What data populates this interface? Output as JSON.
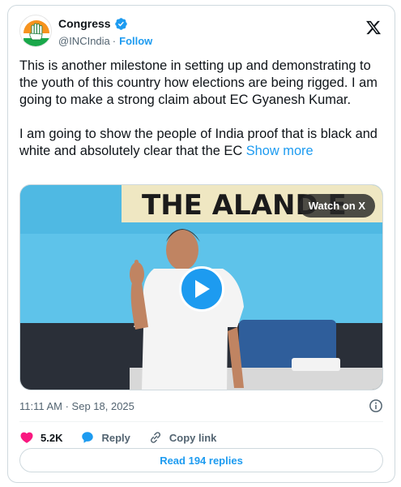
{
  "account": {
    "name": "Congress",
    "handle": "@INCIndia",
    "separator": "·",
    "follow_label": "Follow",
    "avatar_icon": "congress-hand-logo",
    "verified_icon": "verified-badge-icon",
    "platform_icon": "x-logo-icon"
  },
  "post": {
    "paragraph1": "This is another milestone in setting up and demonstrating to the youth of this country how elections are being rigged. I am going to make a strong claim about EC Gyanesh Kumar.",
    "paragraph2": "I am going to show the people of India proof that is black and white and absolutely clear that the EC",
    "show_more": "Show more"
  },
  "media": {
    "watch_label": "Watch on X",
    "banner_text": "THE ALAND E",
    "play_icon": "play-icon"
  },
  "meta": {
    "timestamp": "11:11 AM · Sep 18, 2025",
    "info_icon": "info-icon"
  },
  "actions": {
    "likes": "5.2K",
    "reply_label": "Reply",
    "copy_link_label": "Copy link"
  },
  "replies_button": "Read 194 replies",
  "colors": {
    "accent": "#1d9bf0",
    "like": "#f91880",
    "text": "#0f1419",
    "secondary": "#536471"
  }
}
